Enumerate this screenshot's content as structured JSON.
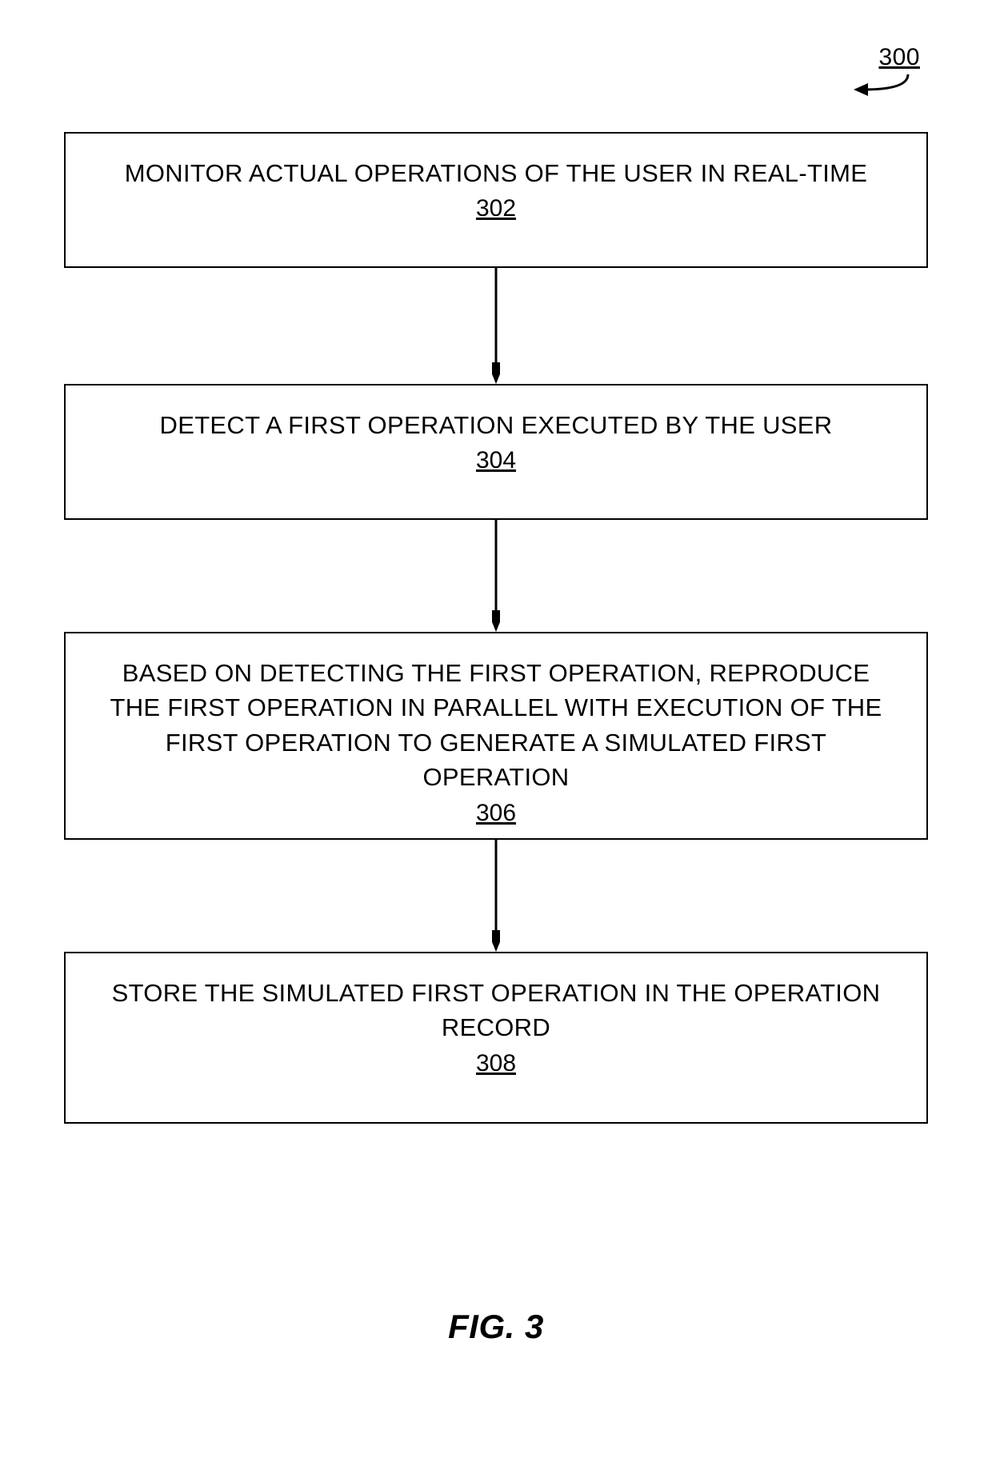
{
  "figure_ref": "300",
  "boxes": [
    {
      "text": "MONITOR ACTUAL OPERATIONS OF THE USER IN REAL-TIME",
      "ref": "302"
    },
    {
      "text": "DETECT A FIRST OPERATION EXECUTED BY THE USER",
      "ref": "304"
    },
    {
      "text": "BASED ON DETECTING THE FIRST OPERATION, REPRODUCE THE FIRST OPERATION IN PARALLEL WITH EXECUTION OF THE FIRST OPERATION TO GENERATE A SIMULATED FIRST OPERATION",
      "ref": "306"
    },
    {
      "text": "STORE THE SIMULATED FIRST OPERATION IN THE OPERATION RECORD",
      "ref": "308"
    }
  ],
  "caption": "FIG. 3"
}
